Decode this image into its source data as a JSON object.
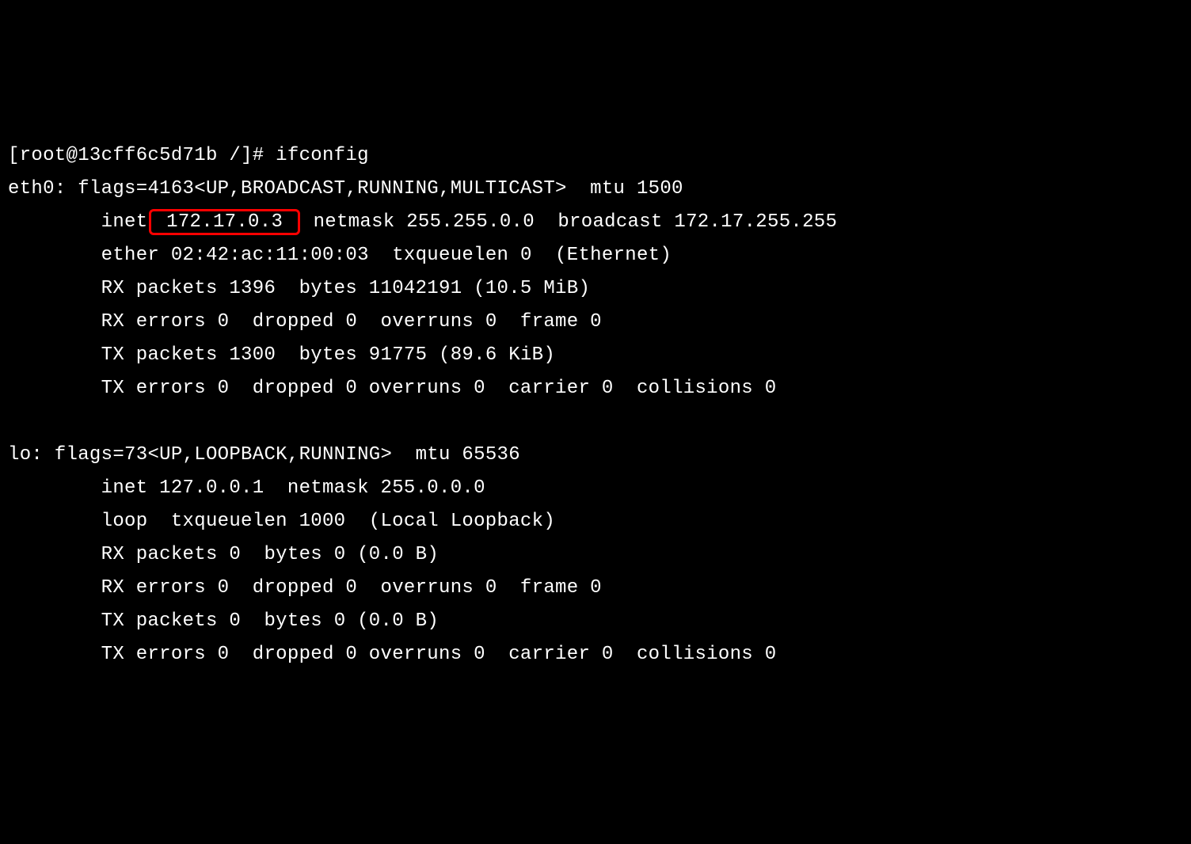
{
  "prompt": {
    "user": "root",
    "host": "13cff6c5d71b",
    "path": "/",
    "symbol": "#",
    "command": "ifconfig"
  },
  "interfaces": {
    "eth0": {
      "name": "eth0",
      "flags_num": "4163",
      "flags_list": "UP,BROADCAST,RUNNING,MULTICAST",
      "mtu": "1500",
      "inet": "172.17.0.3",
      "netmask": "255.255.0.0",
      "broadcast": "172.17.255.255",
      "ether": "02:42:ac:11:00:03",
      "txqueuelen": "0",
      "link_type": "Ethernet",
      "rx_packets": "1396",
      "rx_bytes": "11042191",
      "rx_bytes_human": "10.5 MiB",
      "rx_errors": "0",
      "rx_dropped": "0",
      "rx_overruns": "0",
      "rx_frame": "0",
      "tx_packets": "1300",
      "tx_bytes": "91775",
      "tx_bytes_human": "89.6 KiB",
      "tx_errors": "0",
      "tx_dropped": "0",
      "tx_overruns": "0",
      "tx_carrier": "0",
      "tx_collisions": "0"
    },
    "lo": {
      "name": "lo",
      "flags_num": "73",
      "flags_list": "UP,LOOPBACK,RUNNING",
      "mtu": "65536",
      "inet": "127.0.0.1",
      "netmask": "255.0.0.0",
      "txqueuelen": "1000",
      "link_type": "Local Loopback",
      "rx_packets": "0",
      "rx_bytes": "0",
      "rx_bytes_human": "0.0 B",
      "rx_errors": "0",
      "rx_dropped": "0",
      "rx_overruns": "0",
      "rx_frame": "0",
      "tx_packets": "0",
      "tx_bytes": "0",
      "tx_bytes_human": "0.0 B",
      "tx_errors": "0",
      "tx_dropped": "0",
      "tx_overruns": "0",
      "tx_carrier": "0",
      "tx_collisions": "0"
    }
  },
  "highlight": {
    "target": "eth0_inet",
    "color": "#ff0000"
  }
}
